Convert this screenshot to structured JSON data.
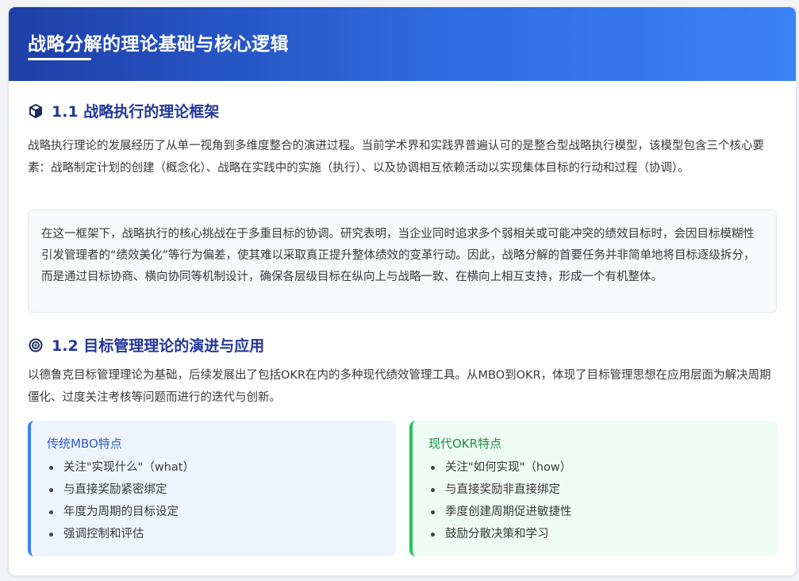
{
  "header": {
    "title": "战略分解的理论基础与核心逻辑"
  },
  "section1": {
    "icon": "cube-icon",
    "title": "1.1 战略执行的理论框架",
    "paragraph": "战略执行理论的发展经历了从单一视角到多维度整合的演进过程。当前学术界和实践界普遍认可的是整合型战略执行模型，该模型包含三个核心要素：战略制定计划的创建（概念化）、战略在实践中的实施（执行）、以及协调相互依赖活动以实现集体目标的行动和过程（协调）。",
    "quote": "在这一框架下，战略执行的核心挑战在于多重目标的协调。研究表明，当企业同时追求多个弱相关或可能冲突的绩效目标时，会因目标模糊性引发管理者的“绩效美化”等行为偏差，使其难以采取真正提升整体绩效的变革行动。因此，战略分解的首要任务并非简单地将目标逐级拆分，而是通过目标协商、横向协同等机制设计，确保各层级目标在纵向上与战略一致、在横向上相互支持，形成一个有机整体。"
  },
  "section2": {
    "icon": "target-icon",
    "title": "1.2 目标管理理论的演进与应用",
    "paragraph": "以德鲁克目标管理理论为基础，后续发展出了包括OKR在内的多种现代绩效管理工具。从MBO到OKR，体现了目标管理思想在应用层面为解决周期僵化、过度关注考核等问题而进行的迭代与创新。",
    "mbo": {
      "title": "传统MBO特点",
      "items": [
        "关注\"实现什么\"（what）",
        "与直接奖励紧密绑定",
        "年度为周期的目标设定",
        "强调控制和评估"
      ]
    },
    "okr": {
      "title": "现代OKR特点",
      "items": [
        "关注\"如何实现\"（how）",
        "与直接奖励非直接绑定",
        "季度创建周期促进敏捷性",
        "鼓励分散决策和学习"
      ]
    }
  },
  "colors": {
    "header_start": "#1e3fa7",
    "header_end": "#3b82f6",
    "section_title": "#23389a",
    "mbo_accent": "#3b82f6",
    "okr_accent": "#22c55e"
  }
}
